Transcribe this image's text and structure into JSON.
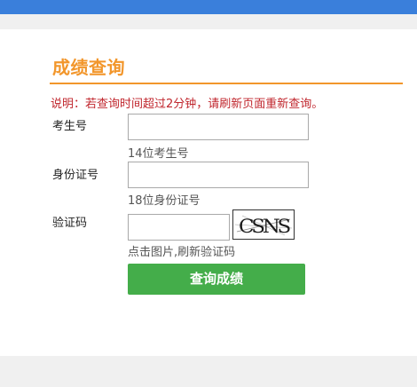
{
  "page": {
    "title": "成绩查询",
    "notice": "说明：若查询时间超过2分钟，请刷新页面重新查询。"
  },
  "form": {
    "exam_number": {
      "label": "考生号",
      "value": "",
      "hint": "14位考生号"
    },
    "id_number": {
      "label": "身份证号",
      "value": "",
      "hint": "18位身份证号"
    },
    "captcha": {
      "label": "验证码",
      "value": "",
      "image_text": "CSNS",
      "hint": "点击图片,刷新验证码"
    },
    "submit_label": "查询成绩"
  },
  "colors": {
    "topbar": "#3a7fdb",
    "title": "#f2962b",
    "notice": "#c0262d",
    "button": "#44ad4a"
  }
}
